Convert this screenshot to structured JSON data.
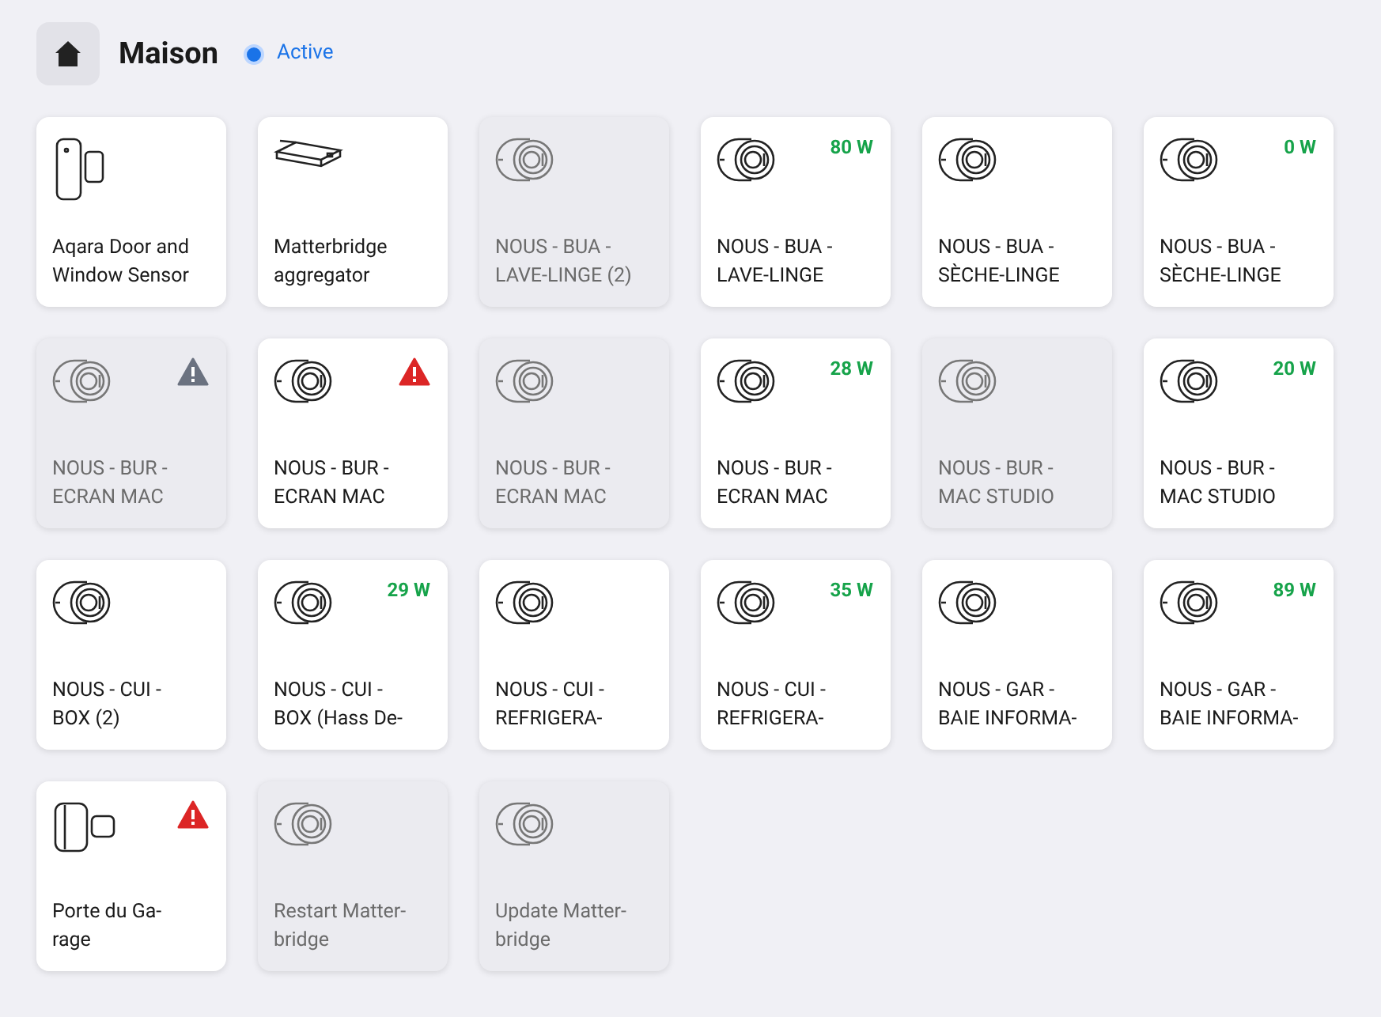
{
  "header": {
    "title": "Maison",
    "status": {
      "label": "Active",
      "selected": true
    }
  },
  "devices": [
    {
      "kind": "door-sensor",
      "available": true,
      "lines": [
        "Aqara Door and",
        "Window Sensor"
      ]
    },
    {
      "kind": "bridge",
      "available": true,
      "lines": [
        "Matterbridge",
        "aggregator"
      ]
    },
    {
      "kind": "plug",
      "available": false,
      "lines": [
        "NOUS - BUA -",
        "LAVE-LINGE (2)"
      ]
    },
    {
      "kind": "plug",
      "available": true,
      "power": "80 W",
      "lines": [
        "NOUS - BUA -",
        "LAVE-LINGE"
      ]
    },
    {
      "kind": "plug",
      "available": true,
      "lines": [
        "NOUS - BUA -",
        "SÈCHE-LINGE"
      ]
    },
    {
      "kind": "plug",
      "available": true,
      "power": "0 W",
      "lines": [
        "NOUS - BUA -",
        "SÈCHE-LINGE"
      ]
    },
    {
      "kind": "plug",
      "available": false,
      "alert": {
        "color": "#6b7280"
      },
      "lines": [
        "NOUS - BUR -",
        "ECRAN MAC"
      ]
    },
    {
      "kind": "plug",
      "available": true,
      "alert": {
        "color": "#dc2626"
      },
      "lines": [
        "NOUS - BUR -",
        "ECRAN MAC"
      ]
    },
    {
      "kind": "plug",
      "available": false,
      "lines": [
        "NOUS - BUR -",
        "ECRAN MAC"
      ]
    },
    {
      "kind": "plug",
      "available": true,
      "power": "28 W",
      "lines": [
        "NOUS - BUR -",
        "ECRAN MAC"
      ]
    },
    {
      "kind": "plug",
      "available": false,
      "lines": [
        "NOUS - BUR -",
        "MAC STUDIO"
      ]
    },
    {
      "kind": "plug",
      "available": true,
      "power": "20 W",
      "lines": [
        "NOUS - BUR -",
        "MAC STUDIO"
      ]
    },
    {
      "kind": "plug",
      "available": true,
      "lines": [
        "NOUS - CUI -",
        "BOX (2)"
      ]
    },
    {
      "kind": "plug",
      "available": true,
      "power": "29 W",
      "lines": [
        "NOUS - CUI -",
        "BOX (Hass De-"
      ]
    },
    {
      "kind": "plug",
      "available": true,
      "lines": [
        "NOUS - CUI -",
        "REFRIGERA-"
      ]
    },
    {
      "kind": "plug",
      "available": true,
      "power": "35 W",
      "lines": [
        "NOUS - CUI -",
        "REFRIGERA-"
      ]
    },
    {
      "kind": "plug",
      "available": true,
      "lines": [
        "NOUS - GAR -",
        "BAIE INFORMA-"
      ]
    },
    {
      "kind": "plug",
      "available": true,
      "power": "89 W",
      "lines": [
        "NOUS - GAR -",
        "BAIE INFORMA-"
      ]
    },
    {
      "kind": "garage-sensor",
      "available": true,
      "alert": {
        "color": "#dc2626"
      },
      "lines": [
        "Porte du Ga-",
        "rage"
      ]
    },
    {
      "kind": "plug",
      "available": false,
      "lines": [
        "Restart Matter-",
        "bridge"
      ]
    },
    {
      "kind": "plug",
      "available": false,
      "lines": [
        "Update Matter-",
        "bridge"
      ]
    }
  ]
}
